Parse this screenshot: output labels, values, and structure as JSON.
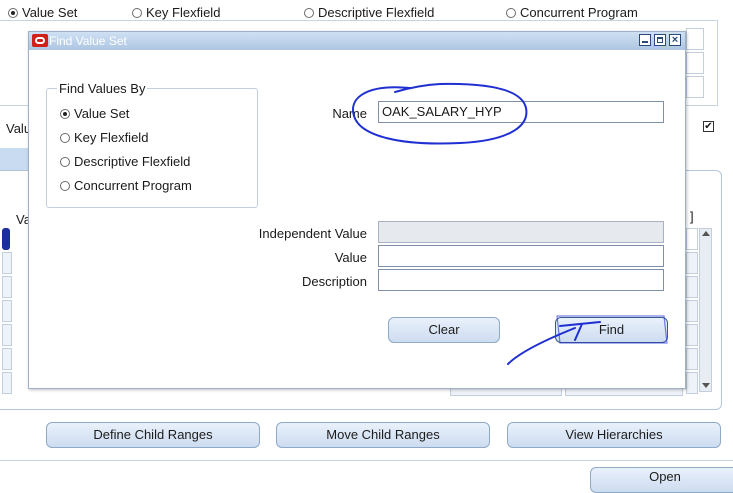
{
  "background": {
    "mode_options": [
      {
        "label": "Value Set",
        "selected": true
      },
      {
        "label": "Key Flexfield",
        "selected": false
      },
      {
        "label": "Descriptive Flexfield",
        "selected": false
      },
      {
        "label": "Concurrent Program",
        "selected": false
      }
    ],
    "left_label_fragment": "Valu",
    "column_fragment": "Va",
    "bracket": "]",
    "buttons": {
      "define_child_ranges": "Define Child Ranges",
      "move_child_ranges": "Move Child Ranges",
      "view_hierarchies": "View Hierarchies",
      "open": "Open"
    }
  },
  "dialog": {
    "title": "Find Value Set",
    "find_values_by": {
      "legend": "Find Values By",
      "options": [
        {
          "label": "Value Set",
          "selected": true
        },
        {
          "label": "Key Flexfield",
          "selected": false
        },
        {
          "label": "Descriptive Flexfield",
          "selected": false
        },
        {
          "label": "Concurrent Program",
          "selected": false
        }
      ]
    },
    "fields": {
      "name": {
        "label": "Name",
        "value": "OAK_SALARY_HYP"
      },
      "independent_value": {
        "label": "Independent Value",
        "value": ""
      },
      "value": {
        "label": "Value",
        "value": ""
      },
      "description": {
        "label": "Description",
        "value": ""
      }
    },
    "buttons": {
      "clear": "Clear",
      "find": "Find"
    }
  },
  "colors": {
    "annotation": "#1f2fd1",
    "titlebar": "#b9cde6",
    "oracle_logo": "#d0201a"
  }
}
